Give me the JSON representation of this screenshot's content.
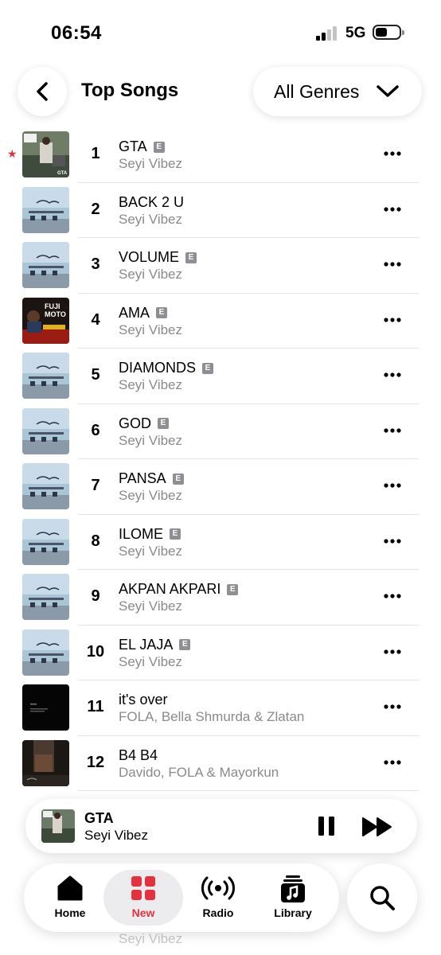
{
  "status_bar": {
    "time": "06:54",
    "network": "5G"
  },
  "header": {
    "title": "Top Songs",
    "genre_label": "All Genres"
  },
  "songs": [
    {
      "rank": "1",
      "title": "GTA",
      "artist": "Seyi Vibez",
      "explicit": true,
      "art": "gta"
    },
    {
      "rank": "2",
      "title": "BACK 2 U",
      "artist": "Seyi Vibez",
      "explicit": false,
      "art": "sky"
    },
    {
      "rank": "3",
      "title": "VOLUME",
      "artist": "Seyi Vibez",
      "explicit": true,
      "art": "sky"
    },
    {
      "rank": "4",
      "title": "AMA",
      "artist": "Seyi Vibez",
      "explicit": true,
      "art": "fuji"
    },
    {
      "rank": "5",
      "title": "DIAMONDS",
      "artist": "Seyi Vibez",
      "explicit": true,
      "art": "sky"
    },
    {
      "rank": "6",
      "title": "GOD",
      "artist": "Seyi Vibez",
      "explicit": true,
      "art": "sky"
    },
    {
      "rank": "7",
      "title": "PANSA",
      "artist": "Seyi Vibez",
      "explicit": true,
      "art": "sky"
    },
    {
      "rank": "8",
      "title": "ILOME",
      "artist": "Seyi Vibez",
      "explicit": true,
      "art": "sky"
    },
    {
      "rank": "9",
      "title": "AKPAN AKPARI",
      "artist": "Seyi Vibez",
      "explicit": true,
      "art": "sky"
    },
    {
      "rank": "10",
      "title": "EL JAJA",
      "artist": "Seyi Vibez",
      "explicit": true,
      "art": "sky"
    },
    {
      "rank": "11",
      "title": "it's over",
      "artist": "FOLA, Bella Shmurda & Zlatan",
      "explicit": false,
      "art": "dark"
    },
    {
      "rank": "12",
      "title": "B4 B4",
      "artist": "Davido, FOLA & Mayorkun",
      "explicit": false,
      "art": "night"
    }
  ],
  "explicit_badge": "E",
  "now_playing": {
    "title": "GTA",
    "artist": "Seyi Vibez"
  },
  "tabs": [
    {
      "label": "Home",
      "icon": "home-icon",
      "active": false
    },
    {
      "label": "New",
      "icon": "grid-icon",
      "active": true
    },
    {
      "label": "Radio",
      "icon": "radio-icon",
      "active": false
    },
    {
      "label": "Library",
      "icon": "library-icon",
      "active": false
    }
  ],
  "background_peek_artist": "Seyi Vibez",
  "colors": {
    "accent": "#e5303f",
    "secondary_text": "#8a8a8e"
  }
}
